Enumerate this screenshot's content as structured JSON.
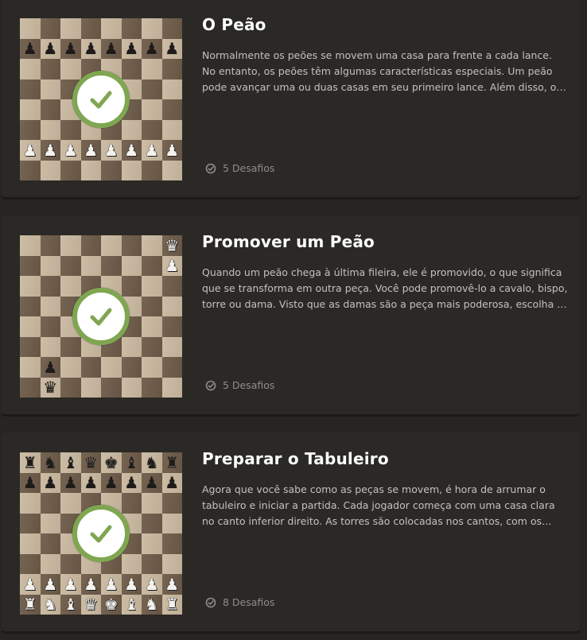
{
  "lessons": [
    {
      "title": "O Peão",
      "description": "Normalmente os peões se movem uma casa para frente a cada lance. No entanto, os peões têm algumas características especiais. Um peão pode avançar uma ou duas casas em seu primeiro lance. Além disso, os peões capturam na diagonal.",
      "challenges": "5 Desafios",
      "completed": true,
      "board": [
        "........",
        "pppppppp",
        "........",
        "........",
        "........",
        "........",
        "PPPPPPPP",
        "........"
      ]
    },
    {
      "title": "Promover um Peão",
      "description": "Quando um peão chega à última fileira, ele é promovido, o que significa que se transforma em outra peça. Você pode promovê-lo a cavalo, bispo, torre ou dama. Visto que as damas são a peça mais poderosa, escolha a dama.",
      "challenges": "5 Desafios",
      "completed": true,
      "board": [
        ".......Q",
        ".......P",
        "........",
        "........",
        "........",
        "........",
        ".p......",
        ".q......"
      ]
    },
    {
      "title": "Preparar o Tabuleiro",
      "description": "Agora que você sabe como as peças se movem, é hora de arrumar o tabuleiro e iniciar a partida. Cada jogador começa com uma casa clara no canto inferior direito. As torres são colocadas nos cantos, com os cavalos ao lado.",
      "challenges": "8 Desafios",
      "completed": true,
      "board": [
        "rnbqkbnr",
        "pppppppp",
        "........",
        "........",
        "........",
        "........",
        "PPPPPPPP",
        "RNBQKBNR"
      ]
    }
  ],
  "icons": {
    "completed": "checkmark-icon",
    "challenges": "check-circle-icon"
  },
  "colors": {
    "page_bg": "#272522",
    "card_bg": "#2b2926",
    "title": "#ffffff",
    "description": "#c3c2c0",
    "muted": "#8f8d8a",
    "accent_green": "#7fa650",
    "board_light": "#c9b89f",
    "board_dark": "#6f5c4a"
  }
}
